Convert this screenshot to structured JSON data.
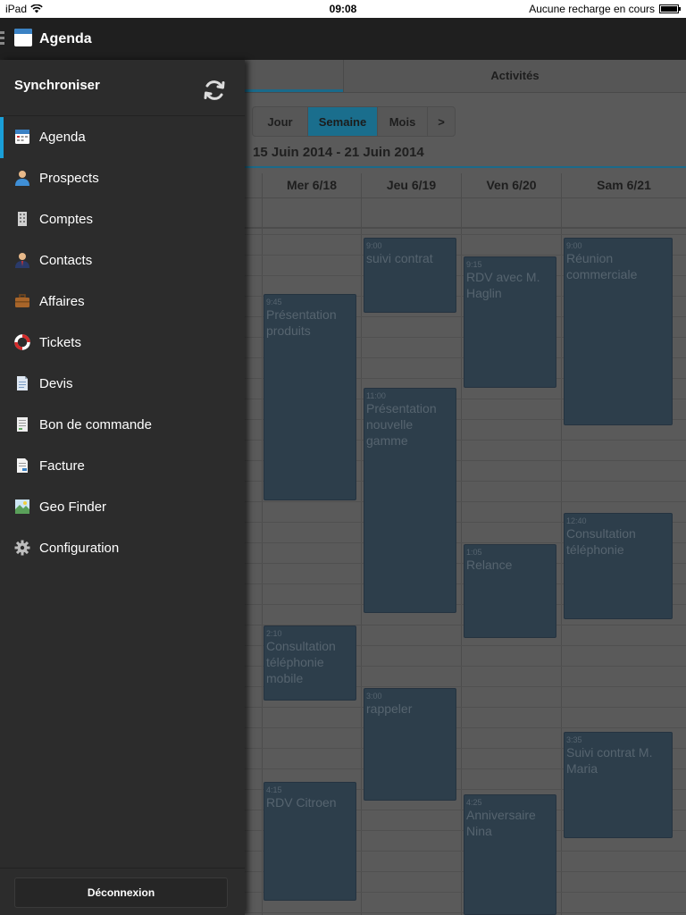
{
  "status_bar": {
    "device": "iPad",
    "time": "09:08",
    "charging": "Aucune recharge en cours"
  },
  "app": {
    "title": "Agenda"
  },
  "tabs": {
    "activites": "Activités"
  },
  "view_selector": {
    "jour": "Jour",
    "semaine": "Semaine",
    "mois": "Mois",
    "next": ">"
  },
  "date_range": "15 Juin 2014 - 21 Juin 2014",
  "days": [
    {
      "label": "Mer 6/18"
    },
    {
      "label": "Jeu 6/19"
    },
    {
      "label": "Ven 6/20"
    },
    {
      "label": "Sam 6/21"
    }
  ],
  "events": {
    "mer_1": {
      "time": "9:45",
      "title": "Présentation produits"
    },
    "mer_2": {
      "time": "2:10",
      "title": "Consultation téléphonie mobile"
    },
    "mer_3": {
      "time": "4:15",
      "title": "RDV Citroen"
    },
    "jeu_1": {
      "time": "9:00",
      "title": "suivi contrat"
    },
    "jeu_2": {
      "time": "11:00",
      "title": "Présentation nouvelle gamme"
    },
    "jeu_3": {
      "time": "3:00",
      "title": "rappeler"
    },
    "ven_1": {
      "time": "9:15",
      "title": "RDV avec M. Haglin"
    },
    "ven_2": {
      "time": "1:05",
      "title": "Relance"
    },
    "ven_3": {
      "time": "4:25",
      "title": "Anniversaire Nina"
    },
    "sam_1": {
      "time": "9:00",
      "title": "Réunion commerciale"
    },
    "sam_2": {
      "time": "12:40",
      "title": "Consultation téléphonie"
    },
    "sam_3": {
      "time": "3:35",
      "title": "Suivi contrat M. Maria"
    }
  },
  "drawer": {
    "sync_title": "Synchroniser",
    "items": [
      {
        "label": "Agenda",
        "icon": "calendar-icon"
      },
      {
        "label": "Prospects",
        "icon": "person-icon"
      },
      {
        "label": "Comptes",
        "icon": "building-icon"
      },
      {
        "label": "Contacts",
        "icon": "contact-icon"
      },
      {
        "label": "Affaires",
        "icon": "briefcase-icon"
      },
      {
        "label": "Tickets",
        "icon": "lifebuoy-icon"
      },
      {
        "label": "Devis",
        "icon": "document-icon"
      },
      {
        "label": "Bon de commande",
        "icon": "order-icon"
      },
      {
        "label": "Facture",
        "icon": "invoice-icon"
      },
      {
        "label": "Geo Finder",
        "icon": "map-icon"
      },
      {
        "label": "Configuration",
        "icon": "gear-icon"
      }
    ],
    "logout": "Déconnexion"
  },
  "colors": {
    "accent": "#1a9fd8",
    "drawer_bg": "#2c2c2c",
    "header_bg": "#1f1f1f",
    "event_bg": "#2d3e4b"
  }
}
